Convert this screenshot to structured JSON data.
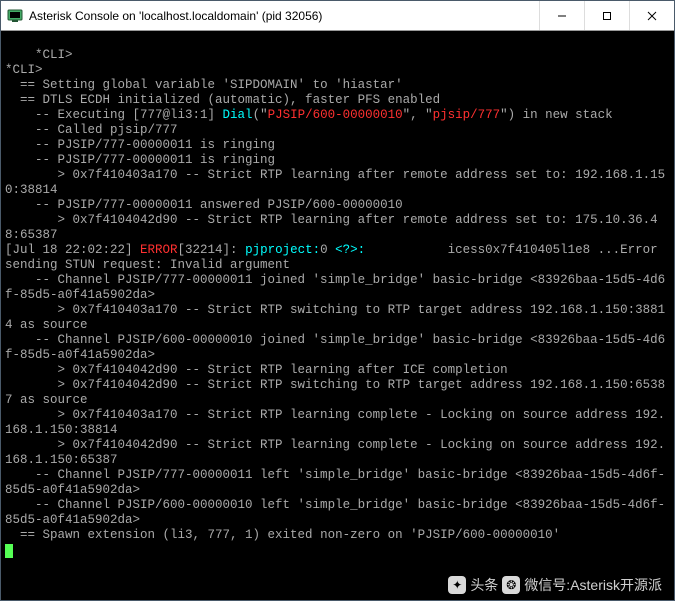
{
  "window": {
    "title": "Asterisk Console on 'localhost.localdomain' (pid 32056)"
  },
  "console": {
    "lines": [
      {
        "segments": [
          {
            "t": "*CLI>",
            "c": ""
          }
        ]
      },
      {
        "segments": [
          {
            "t": "*CLI>",
            "c": ""
          }
        ]
      },
      {
        "segments": [
          {
            "t": "  == Setting global variable 'SIPDOMAIN' to 'hiastar'",
            "c": ""
          }
        ]
      },
      {
        "segments": [
          {
            "t": "  == DTLS ECDH initialized (automatic), faster PFS enabled",
            "c": ""
          }
        ]
      },
      {
        "segments": [
          {
            "t": "    -- Executing [777@li3:1] ",
            "c": ""
          },
          {
            "t": "Dial",
            "c": "cyan"
          },
          {
            "t": "(\"",
            "c": ""
          },
          {
            "t": "PJSIP/600-00000010",
            "c": "red"
          },
          {
            "t": "\", \"",
            "c": ""
          },
          {
            "t": "pjsip/777",
            "c": "red"
          },
          {
            "t": "\") in new stack",
            "c": ""
          }
        ]
      },
      {
        "segments": [
          {
            "t": "    -- Called pjsip/777",
            "c": ""
          }
        ]
      },
      {
        "segments": [
          {
            "t": "    -- PJSIP/777-00000011 is ringing",
            "c": ""
          }
        ]
      },
      {
        "segments": [
          {
            "t": "    -- PJSIP/777-00000011 is ringing",
            "c": ""
          }
        ]
      },
      {
        "segments": [
          {
            "t": "       > 0x7f410403a170 -- Strict RTP learning after remote address set to: 192.168.1.150:38814",
            "c": ""
          }
        ]
      },
      {
        "segments": [
          {
            "t": "    -- PJSIP/777-00000011 answered PJSIP/600-00000010",
            "c": ""
          }
        ]
      },
      {
        "segments": [
          {
            "t": "       > 0x7f4104042d90 -- Strict RTP learning after remote address set to: 175.10.36.48:65387",
            "c": ""
          }
        ]
      },
      {
        "segments": [
          {
            "t": "[Jul 18 22:02:22] ",
            "c": ""
          },
          {
            "t": "ERROR",
            "c": "red"
          },
          {
            "t": "[32214]: ",
            "c": ""
          },
          {
            "t": "pjproject:",
            "c": "cyan"
          },
          {
            "t": "0 ",
            "c": ""
          },
          {
            "t": "<?>:",
            "c": "cyan"
          },
          {
            "t": "           icess0x7f410405l1e8 ...Error sending STUN request: Invalid argument",
            "c": ""
          }
        ]
      },
      {
        "segments": [
          {
            "t": "    -- Channel PJSIP/777-00000011 joined 'simple_bridge' basic-bridge <83926baa-15d5-4d6f-85d5-a0f41a5902da>",
            "c": ""
          }
        ]
      },
      {
        "segments": [
          {
            "t": "       > 0x7f410403a170 -- Strict RTP switching to RTP target address 192.168.1.150:38814 as source",
            "c": ""
          }
        ]
      },
      {
        "segments": [
          {
            "t": "    -- Channel PJSIP/600-00000010 joined 'simple_bridge' basic-bridge <83926baa-15d5-4d6f-85d5-a0f41a5902da>",
            "c": ""
          }
        ]
      },
      {
        "segments": [
          {
            "t": "       > 0x7f4104042d90 -- Strict RTP learning after ICE completion",
            "c": ""
          }
        ]
      },
      {
        "segments": [
          {
            "t": "       > 0x7f4104042d90 -- Strict RTP switching to RTP target address 192.168.1.150:65387 as source",
            "c": ""
          }
        ]
      },
      {
        "segments": [
          {
            "t": "       > 0x7f410403a170 -- Strict RTP learning complete - Locking on source address 192.168.1.150:38814",
            "c": ""
          }
        ]
      },
      {
        "segments": [
          {
            "t": "       > 0x7f4104042d90 -- Strict RTP learning complete - Locking on source address 192.168.1.150:65387",
            "c": ""
          }
        ]
      },
      {
        "segments": [
          {
            "t": "    -- Channel PJSIP/777-00000011 left 'simple_bridge' basic-bridge <83926baa-15d5-4d6f-85d5-a0f41a5902da>",
            "c": ""
          }
        ]
      },
      {
        "segments": [
          {
            "t": "    -- Channel PJSIP/600-00000010 left 'simple_bridge' basic-bridge <83926baa-15d5-4d6f-85d5-a0f41a5902da>",
            "c": ""
          }
        ]
      },
      {
        "segments": [
          {
            "t": "  == Spawn extension (li3, 777, 1) exited non-zero on 'PJSIP/600-00000010'",
            "c": ""
          }
        ]
      }
    ]
  },
  "watermark": {
    "label1": "头条",
    "label2": "微信号:Asterisk开源派"
  }
}
